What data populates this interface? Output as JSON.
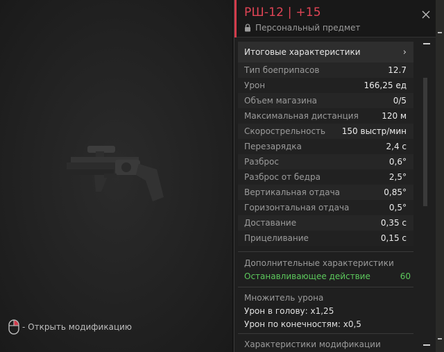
{
  "viewport": {
    "hint_text": "- Открыть модификацию"
  },
  "item": {
    "title": "РШ-12 | +15",
    "subtitle": "Персональный предмет"
  },
  "stats_section": {
    "header": "Итоговые характеристики",
    "rows": [
      {
        "label": "Тип боеприпасов",
        "value": "12.7"
      },
      {
        "label": "Урон",
        "value": "166,25 ед"
      },
      {
        "label": "Объем магазина",
        "value": "0/5"
      },
      {
        "label": "Максимальная дистанция",
        "value": "120 м"
      },
      {
        "label": "Скорострельность",
        "value": "150 выстр/мин"
      },
      {
        "label": "Перезарядка",
        "value": "2,4 с"
      },
      {
        "label": "Разброс",
        "value": "0,6°"
      },
      {
        "label": "Разброс от бедра",
        "value": "2,5°"
      },
      {
        "label": "Вертикальная отдача",
        "value": "0,85°"
      },
      {
        "label": "Горизонтальная отдача",
        "value": "0,5°"
      },
      {
        "label": "Доставание",
        "value": "0,35 с"
      },
      {
        "label": "Прицеливание",
        "value": "0,15 с"
      }
    ]
  },
  "additional": {
    "title": "Дополнительные характеристики",
    "stopping_label": "Останавливающее действие",
    "stopping_value": "60"
  },
  "multiplier": {
    "title": "Множитель урона",
    "head": "Урон в голову: x1,25",
    "limbs": "Урон по конечностям: x0,5"
  },
  "mods": {
    "title": "Характеристики модификации"
  },
  "colors": {
    "accent": "#d23b4b",
    "title": "#e04455",
    "positive": "#5cc85c"
  }
}
